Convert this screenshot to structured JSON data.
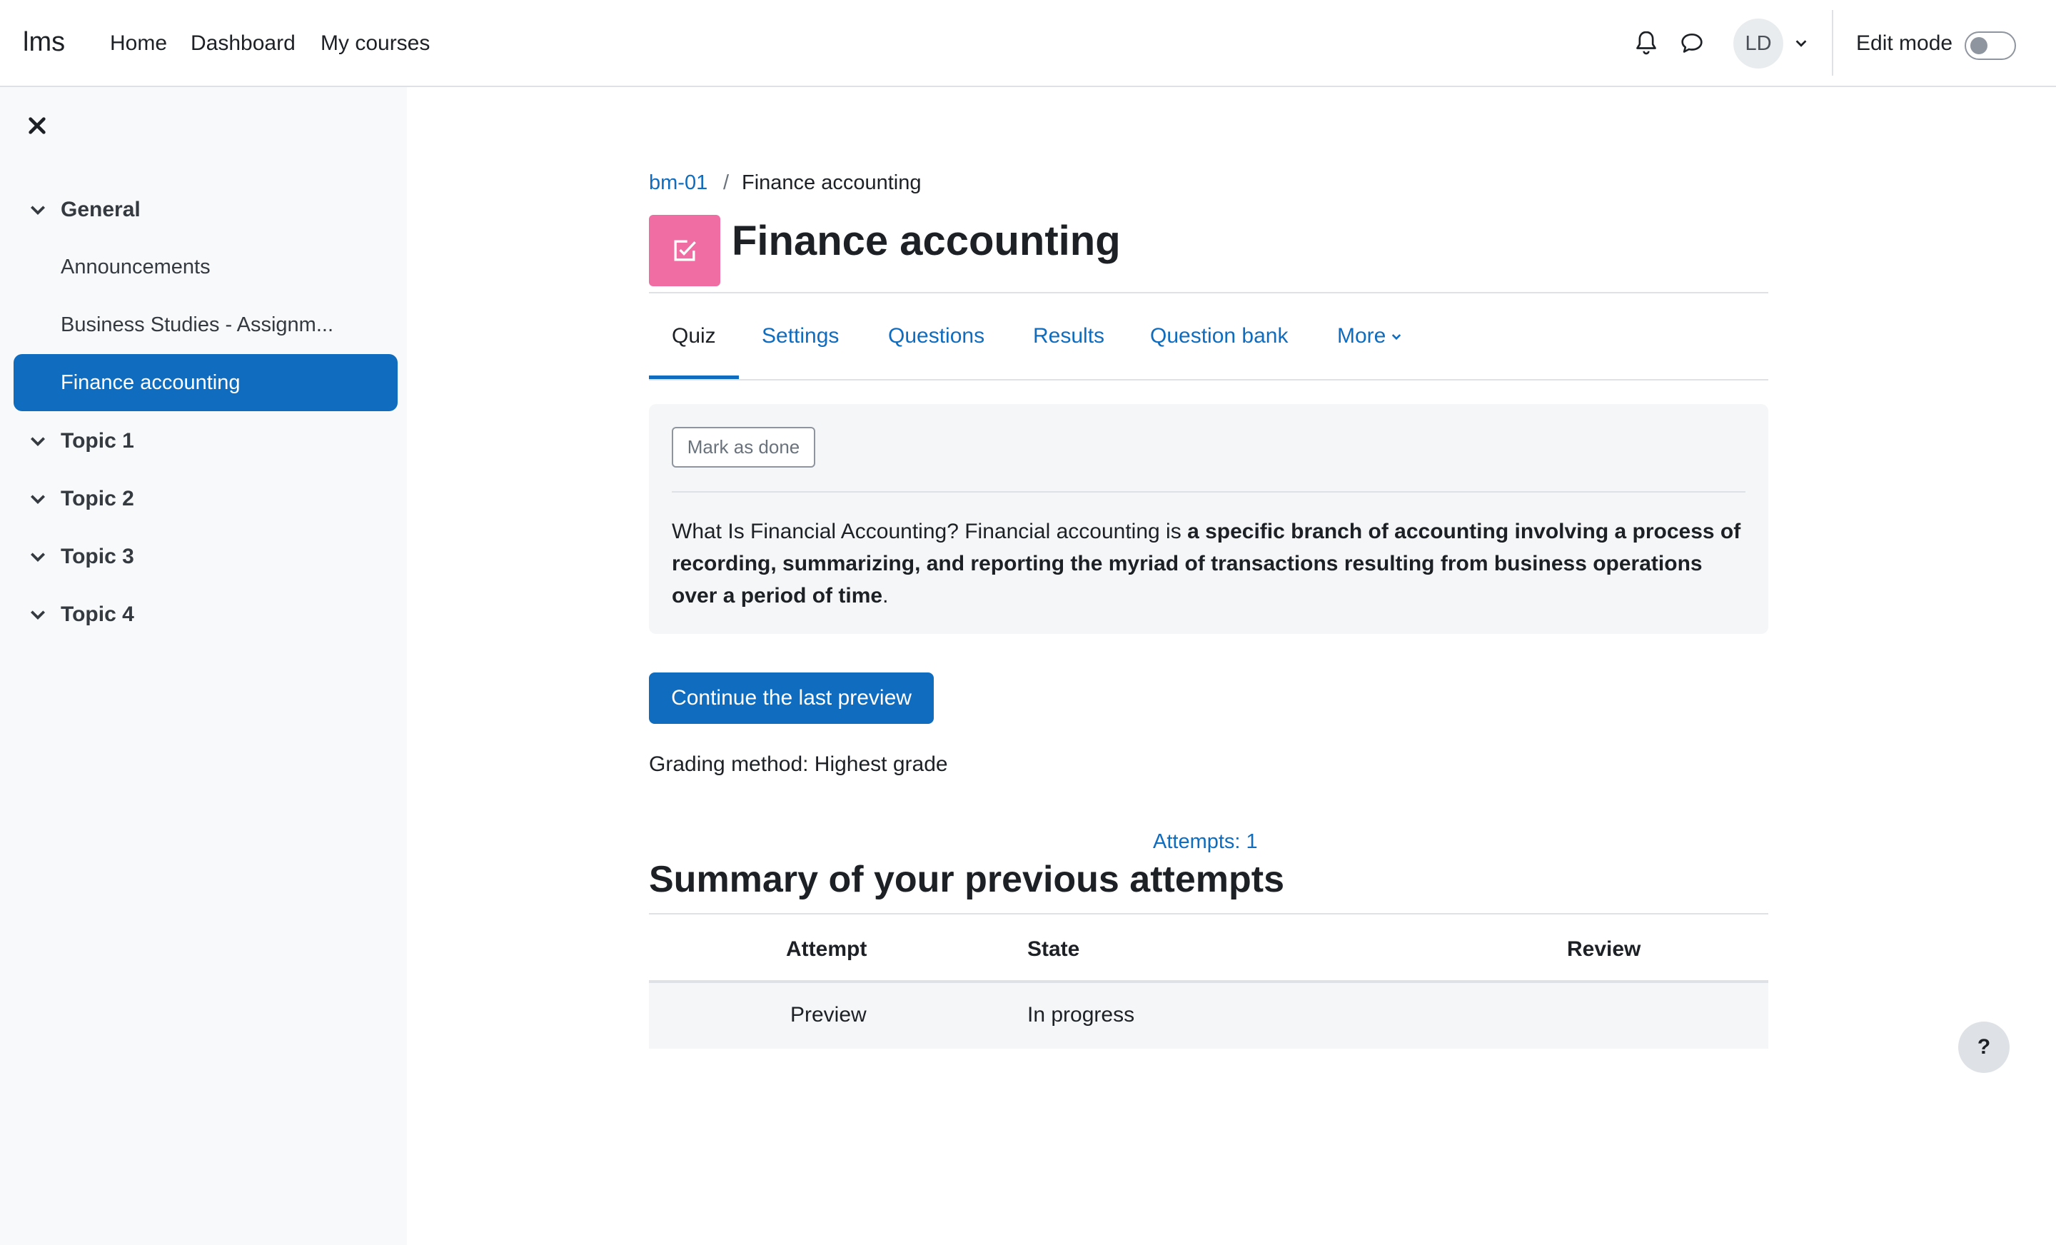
{
  "navbar": {
    "brand": "lms",
    "links": [
      "Home",
      "Dashboard",
      "My courses"
    ],
    "icons": [
      "bell-icon",
      "chat-bubble-icon"
    ],
    "avatar_initials": "LD",
    "edit_mode_label": "Edit mode",
    "edit_mode_on": false
  },
  "drawer": {
    "sections": [
      {
        "title": "General",
        "items": [
          "Announcements",
          "Business Studies - Assignm...",
          "Finance accounting"
        ]
      },
      {
        "title": "Topic 1"
      },
      {
        "title": "Topic 2"
      },
      {
        "title": "Topic 3"
      },
      {
        "title": "Topic 4"
      }
    ],
    "active_item": "Finance accounting"
  },
  "breadcrumb": {
    "course": "bm-01",
    "separator": "/",
    "current": "Finance accounting"
  },
  "page": {
    "title": "Finance accounting",
    "icon_color": "#f06da4"
  },
  "tabs": {
    "items": [
      "Quiz",
      "Settings",
      "Questions",
      "Results",
      "Question bank",
      "More"
    ],
    "active": "Quiz"
  },
  "intro": {
    "mark_as_done": "Mark as done",
    "text_plain_1": "What Is Financial Accounting? Financial accounting is ",
    "text_bold": "a specific branch of accounting involving a process of recording, summarizing, and reporting the myriad of transactions resulting from business operations over a period of time",
    "text_plain_2": "."
  },
  "actions": {
    "continue_button": "Continue the last preview",
    "grading_method": "Grading method: Highest grade",
    "attempts_link": "Attempts: 1"
  },
  "summary": {
    "title": "Summary of your previous attempts",
    "columns": [
      "Attempt",
      "State",
      "Review"
    ],
    "rows": [
      {
        "attempt": "Preview",
        "state": "In progress",
        "review": ""
      }
    ]
  },
  "help": {
    "label": "?"
  },
  "colors": {
    "primary": "#0f6cbf",
    "drawer_bg": "#f8f9fa",
    "quiz_icon": "#f06da4"
  }
}
